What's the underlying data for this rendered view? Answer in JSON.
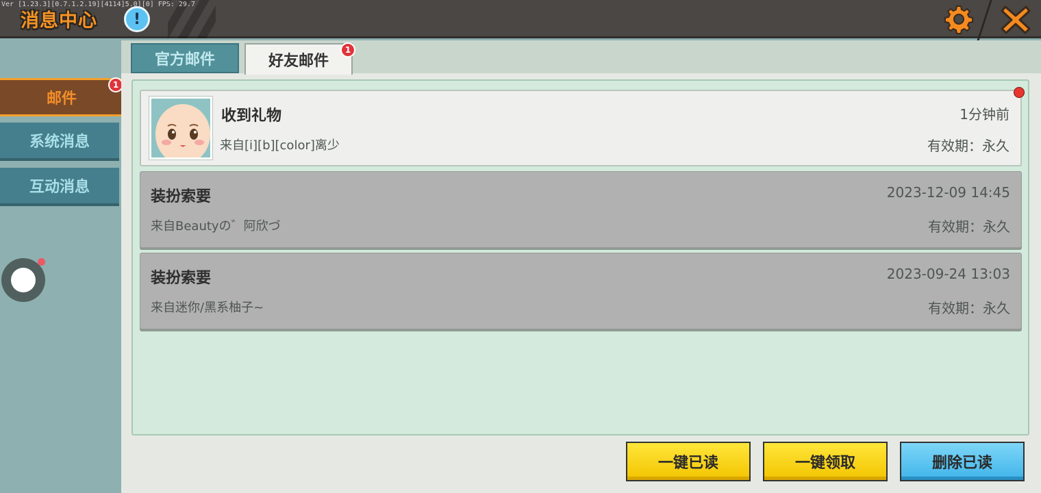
{
  "header": {
    "title": "消息中心",
    "version_text": "Ver [1.23.3][0.7.1.2.19][4114]5.0][0] FPS: 29.7",
    "info_symbol": "!"
  },
  "sidebar": {
    "items": [
      {
        "label": "邮件",
        "badge": "1",
        "active": true
      },
      {
        "label": "系统消息",
        "active": false
      },
      {
        "label": "互动消息",
        "active": false
      }
    ]
  },
  "tabs": [
    {
      "label": "官方邮件",
      "active": false
    },
    {
      "label": "好友邮件",
      "active": true,
      "badge": "1"
    }
  ],
  "mails": [
    {
      "title": "收到礼物",
      "sender": "来自[i][b][color]离少",
      "time": "1分钟前",
      "expiry": "有效期：永久",
      "unread": true
    },
    {
      "title": "装扮索要",
      "sender": "来自Beautyの゛阿欣づ",
      "time": "2023-12-09 14:45",
      "expiry": "有效期：永久",
      "unread": false
    },
    {
      "title": "装扮索要",
      "sender": "来自迷你/黑系柚子~",
      "time": "2023-09-24 13:03",
      "expiry": "有效期：永久",
      "unread": false
    }
  ],
  "actions": {
    "read_all": "一键已读",
    "claim_all": "一键领取",
    "delete_read": "删除已读"
  },
  "colors": {
    "title_orange": "#f59324",
    "active_side_tab": "#7a4928",
    "inactive_side_tab": "#457f8d",
    "content_green": "#d3eadc",
    "button_yellow": "#ffe63a",
    "button_blue": "#3fb4ea",
    "badge_red": "#e0343a"
  },
  "icons": [
    "info-icon",
    "gear-icon",
    "close-icon",
    "floating-ball-icon",
    "avatar-face-icon"
  ]
}
